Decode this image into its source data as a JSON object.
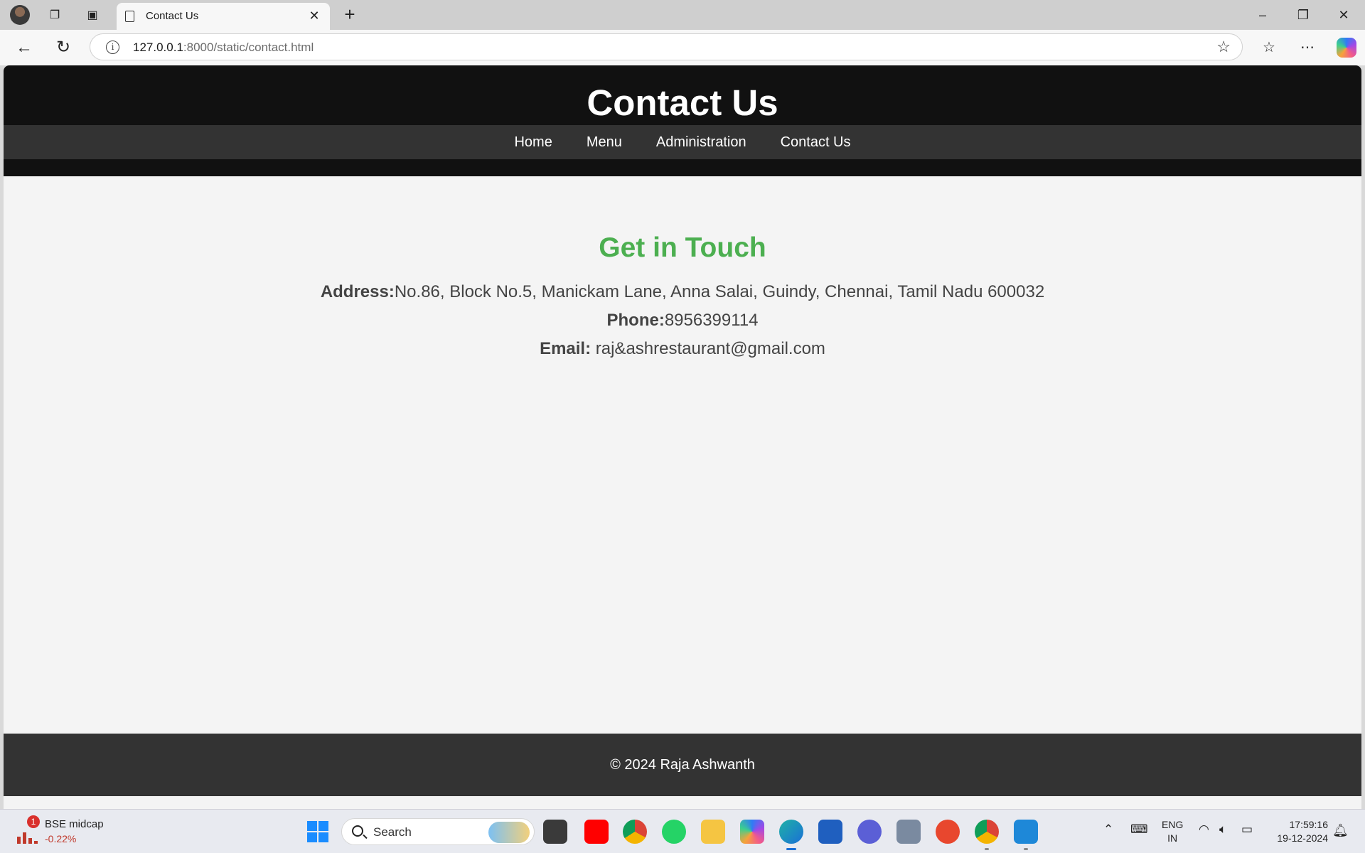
{
  "browser": {
    "tab_title": "Contact Us",
    "url_host": "127.0.0.1",
    "url_rest": ":8000/static/contact.html",
    "icons": [
      "profile-avatar",
      "workspaces-icon",
      "tab-actions-icon",
      "page-icon",
      "close-icon",
      "new-tab-icon",
      "minimize-icon",
      "restore-icon",
      "window-close-icon",
      "back-icon",
      "refresh-icon",
      "site-info-icon",
      "favorite-star-icon",
      "favorites-icon",
      "more-icon",
      "copilot-icon"
    ]
  },
  "site": {
    "title": "Contact Us",
    "nav": [
      "Home",
      "Menu",
      "Administration",
      "Contact Us"
    ],
    "heading": "Get in Touch",
    "heading_color": "#4caf50",
    "address_label": "Address:",
    "address_value": "No.86, Block No.5, Manickam Lane, Anna Salai, Guindy, Chennai, Tamil Nadu 600032",
    "phone_label": "Phone:",
    "phone_value": "8956399114",
    "email_label": "Email:",
    "email_value": " raj&ashrestaurant@gmail.com",
    "footer": "© 2024 Raja Ashwanth"
  },
  "taskbar": {
    "stock_name": "BSE midcap",
    "stock_change": "-0.22%",
    "stock_badge": "1",
    "search_label": "Search",
    "apps": [
      "file-explorer-icon",
      "youtube-icon",
      "chrome-icon",
      "whatsapp-icon",
      "folder-icon",
      "copilot-app-icon",
      "edge-icon",
      "store-icon",
      "app-icon",
      "camera-icon",
      "wps-icon",
      "chrome-profile-icon",
      "vscode-icon"
    ],
    "lang_line1": "ENG",
    "lang_line2": "IN",
    "time": "17:59:16",
    "date": "19-12-2024"
  }
}
